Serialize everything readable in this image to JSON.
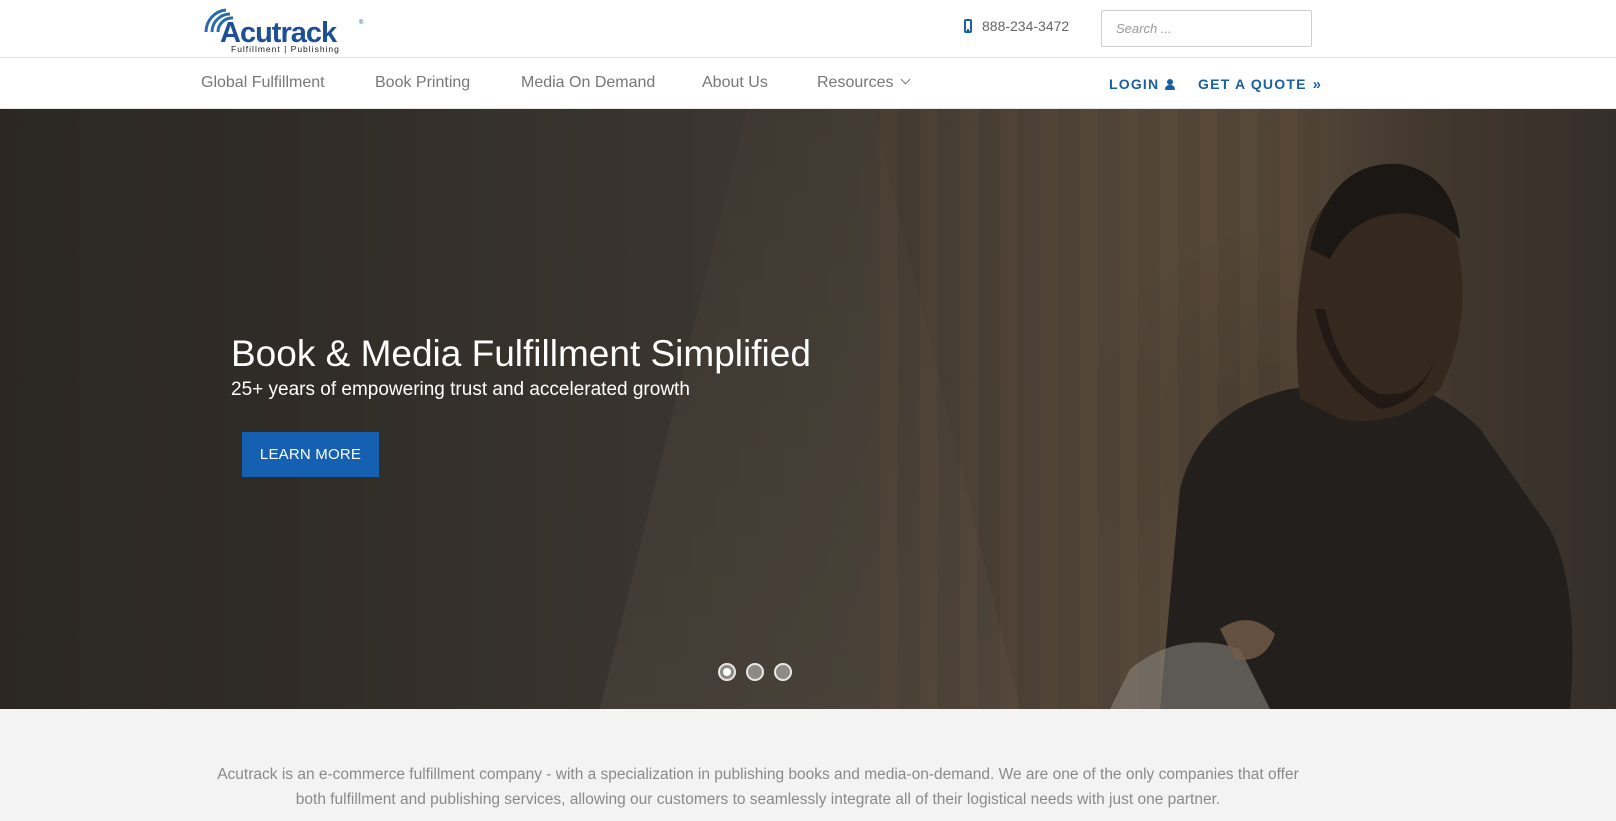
{
  "brand": {
    "name": "Acutrack",
    "tagline": "Fulfillment | Publishing",
    "color": "#1b5fa3"
  },
  "header": {
    "phone": "888-234-3472",
    "search_placeholder": "Search ..."
  },
  "nav": {
    "items": [
      {
        "label": "Global Fulfillment"
      },
      {
        "label": "Book Printing"
      },
      {
        "label": "Media On Demand"
      },
      {
        "label": "About Us"
      },
      {
        "label": "Resources",
        "has_dropdown": true
      }
    ],
    "login_label": "LOGIN",
    "quote_label": "GET A QUOTE"
  },
  "hero": {
    "title": "Book & Media Fulfillment Simplified",
    "subtitle": "25+ years of empowering trust and accelerated growth",
    "button_label": "LEARN MORE",
    "button_color": "#1660b1",
    "slides_total": 3,
    "active_slide": 1
  },
  "intro": {
    "text": "Acutrack is an e-commerce fulfillment company - with a specialization in publishing books and media-on-demand. We are one of the only companies that offer both fulfillment and publishing services, allowing our customers to seamlessly integrate all of their logistical needs with just one partner."
  }
}
